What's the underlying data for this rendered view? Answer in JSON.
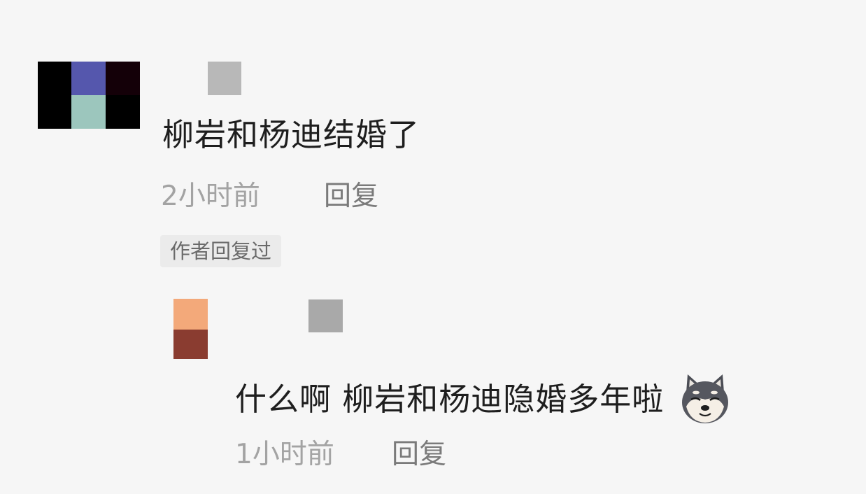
{
  "comments": [
    {
      "text": "柳岩和杨迪结婚了",
      "time": "2小时前",
      "reply_label": "回复",
      "author_replied_badge": "作者回复过",
      "avatar_colors": [
        "#000000",
        "#5557ad",
        "#140008",
        "#000000",
        "#9cc6bd",
        "#000000"
      ],
      "name_censor_color": "#b8b8b8"
    }
  ],
  "reply": {
    "text": "什么啊 柳岩和杨迪隐婚多年啦",
    "emoji": "doge-icon",
    "time": "1小时前",
    "reply_label": "回复",
    "avatar_colors": [
      "#f3a97a",
      "#8a3c30"
    ],
    "name_censor_color": "#a9a9a9"
  }
}
